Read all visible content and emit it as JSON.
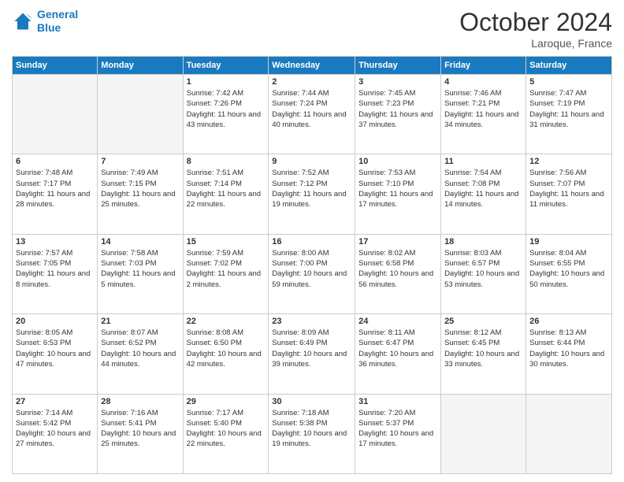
{
  "header": {
    "logo_line1": "General",
    "logo_line2": "Blue",
    "month": "October 2024",
    "location": "Laroque, France"
  },
  "days_of_week": [
    "Sunday",
    "Monday",
    "Tuesday",
    "Wednesday",
    "Thursday",
    "Friday",
    "Saturday"
  ],
  "weeks": [
    [
      {
        "day": "",
        "info": ""
      },
      {
        "day": "",
        "info": ""
      },
      {
        "day": "1",
        "info": "Sunrise: 7:42 AM\nSunset: 7:26 PM\nDaylight: 11 hours and 43 minutes."
      },
      {
        "day": "2",
        "info": "Sunrise: 7:44 AM\nSunset: 7:24 PM\nDaylight: 11 hours and 40 minutes."
      },
      {
        "day": "3",
        "info": "Sunrise: 7:45 AM\nSunset: 7:23 PM\nDaylight: 11 hours and 37 minutes."
      },
      {
        "day": "4",
        "info": "Sunrise: 7:46 AM\nSunset: 7:21 PM\nDaylight: 11 hours and 34 minutes."
      },
      {
        "day": "5",
        "info": "Sunrise: 7:47 AM\nSunset: 7:19 PM\nDaylight: 11 hours and 31 minutes."
      }
    ],
    [
      {
        "day": "6",
        "info": "Sunrise: 7:48 AM\nSunset: 7:17 PM\nDaylight: 11 hours and 28 minutes."
      },
      {
        "day": "7",
        "info": "Sunrise: 7:49 AM\nSunset: 7:15 PM\nDaylight: 11 hours and 25 minutes."
      },
      {
        "day": "8",
        "info": "Sunrise: 7:51 AM\nSunset: 7:14 PM\nDaylight: 11 hours and 22 minutes."
      },
      {
        "day": "9",
        "info": "Sunrise: 7:52 AM\nSunset: 7:12 PM\nDaylight: 11 hours and 19 minutes."
      },
      {
        "day": "10",
        "info": "Sunrise: 7:53 AM\nSunset: 7:10 PM\nDaylight: 11 hours and 17 minutes."
      },
      {
        "day": "11",
        "info": "Sunrise: 7:54 AM\nSunset: 7:08 PM\nDaylight: 11 hours and 14 minutes."
      },
      {
        "day": "12",
        "info": "Sunrise: 7:56 AM\nSunset: 7:07 PM\nDaylight: 11 hours and 11 minutes."
      }
    ],
    [
      {
        "day": "13",
        "info": "Sunrise: 7:57 AM\nSunset: 7:05 PM\nDaylight: 11 hours and 8 minutes."
      },
      {
        "day": "14",
        "info": "Sunrise: 7:58 AM\nSunset: 7:03 PM\nDaylight: 11 hours and 5 minutes."
      },
      {
        "day": "15",
        "info": "Sunrise: 7:59 AM\nSunset: 7:02 PM\nDaylight: 11 hours and 2 minutes."
      },
      {
        "day": "16",
        "info": "Sunrise: 8:00 AM\nSunset: 7:00 PM\nDaylight: 10 hours and 59 minutes."
      },
      {
        "day": "17",
        "info": "Sunrise: 8:02 AM\nSunset: 6:58 PM\nDaylight: 10 hours and 56 minutes."
      },
      {
        "day": "18",
        "info": "Sunrise: 8:03 AM\nSunset: 6:57 PM\nDaylight: 10 hours and 53 minutes."
      },
      {
        "day": "19",
        "info": "Sunrise: 8:04 AM\nSunset: 6:55 PM\nDaylight: 10 hours and 50 minutes."
      }
    ],
    [
      {
        "day": "20",
        "info": "Sunrise: 8:05 AM\nSunset: 6:53 PM\nDaylight: 10 hours and 47 minutes."
      },
      {
        "day": "21",
        "info": "Sunrise: 8:07 AM\nSunset: 6:52 PM\nDaylight: 10 hours and 44 minutes."
      },
      {
        "day": "22",
        "info": "Sunrise: 8:08 AM\nSunset: 6:50 PM\nDaylight: 10 hours and 42 minutes."
      },
      {
        "day": "23",
        "info": "Sunrise: 8:09 AM\nSunset: 6:49 PM\nDaylight: 10 hours and 39 minutes."
      },
      {
        "day": "24",
        "info": "Sunrise: 8:11 AM\nSunset: 6:47 PM\nDaylight: 10 hours and 36 minutes."
      },
      {
        "day": "25",
        "info": "Sunrise: 8:12 AM\nSunset: 6:45 PM\nDaylight: 10 hours and 33 minutes."
      },
      {
        "day": "26",
        "info": "Sunrise: 8:13 AM\nSunset: 6:44 PM\nDaylight: 10 hours and 30 minutes."
      }
    ],
    [
      {
        "day": "27",
        "info": "Sunrise: 7:14 AM\nSunset: 5:42 PM\nDaylight: 10 hours and 27 minutes."
      },
      {
        "day": "28",
        "info": "Sunrise: 7:16 AM\nSunset: 5:41 PM\nDaylight: 10 hours and 25 minutes."
      },
      {
        "day": "29",
        "info": "Sunrise: 7:17 AM\nSunset: 5:40 PM\nDaylight: 10 hours and 22 minutes."
      },
      {
        "day": "30",
        "info": "Sunrise: 7:18 AM\nSunset: 5:38 PM\nDaylight: 10 hours and 19 minutes."
      },
      {
        "day": "31",
        "info": "Sunrise: 7:20 AM\nSunset: 5:37 PM\nDaylight: 10 hours and 17 minutes."
      },
      {
        "day": "",
        "info": ""
      },
      {
        "day": "",
        "info": ""
      }
    ]
  ]
}
